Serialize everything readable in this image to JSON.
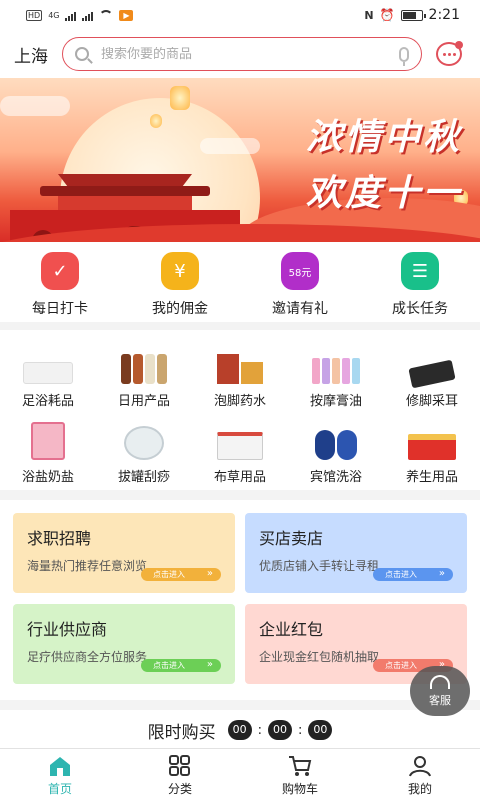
{
  "status_bar": {
    "left_labels": [
      "HD",
      "HD"
    ],
    "network": "4G",
    "time": "2:21",
    "app_badge": "▶"
  },
  "header": {
    "city": "上海",
    "search_placeholder": "搜索你要的商品"
  },
  "banner": {
    "line1": "浓情中秋",
    "line2": "欢度十一"
  },
  "quick_actions": [
    {
      "label": "每日打卡",
      "icon": "calendar-check-icon",
      "color": "#f0504f"
    },
    {
      "label": "我的佣金",
      "icon": "money-bag-icon",
      "color": "#f5b31b"
    },
    {
      "label": "邀请有礼",
      "icon": "gift-badge-icon",
      "color": "#b12ec9",
      "badge": "58元"
    },
    {
      "label": "成长任务",
      "icon": "task-list-icon",
      "color": "#19c08a"
    }
  ],
  "categories": [
    {
      "label": "足浴耗品"
    },
    {
      "label": "日用产品"
    },
    {
      "label": "泡脚药水"
    },
    {
      "label": "按摩膏油"
    },
    {
      "label": "修脚采耳"
    },
    {
      "label": "浴盐奶盐"
    },
    {
      "label": "拔罐刮痧"
    },
    {
      "label": "布草用品"
    },
    {
      "label": "宾馆洗浴"
    },
    {
      "label": "养生用品"
    }
  ],
  "service_cards": [
    {
      "title": "求职招聘",
      "subtitle": "海量热门推荐任意浏览",
      "cta": "点击进入",
      "bg": "#fde6b8",
      "accent": "#f2b13b"
    },
    {
      "title": "买店卖店",
      "subtitle": "优质店铺入手转让寻租",
      "cta": "点击进入",
      "bg": "#c6dcff",
      "accent": "#5b95ef"
    },
    {
      "title": "行业供应商",
      "subtitle": "足疗供应商全方位服务",
      "cta": "点击进入",
      "bg": "#d6f3c8",
      "accent": "#6ccf56"
    },
    {
      "title": "企业红包",
      "subtitle": "企业现金红包随机抽取",
      "cta": "点击进入",
      "bg": "#ffd8d2",
      "accent": "#f27b6c"
    }
  ],
  "flash_sale": {
    "title": "限时购买",
    "hours": "00",
    "minutes": "00",
    "seconds": "00"
  },
  "floating_service": {
    "label": "客服"
  },
  "tab_bar": [
    {
      "label": "首页",
      "icon": "home-icon",
      "active": true
    },
    {
      "label": "分类",
      "icon": "grid-icon",
      "active": false
    },
    {
      "label": "购物车",
      "icon": "cart-icon",
      "active": false
    },
    {
      "label": "我的",
      "icon": "user-icon",
      "active": false
    }
  ],
  "colors": {
    "accent": "#2db5b0",
    "search_border": "#e0505a"
  }
}
